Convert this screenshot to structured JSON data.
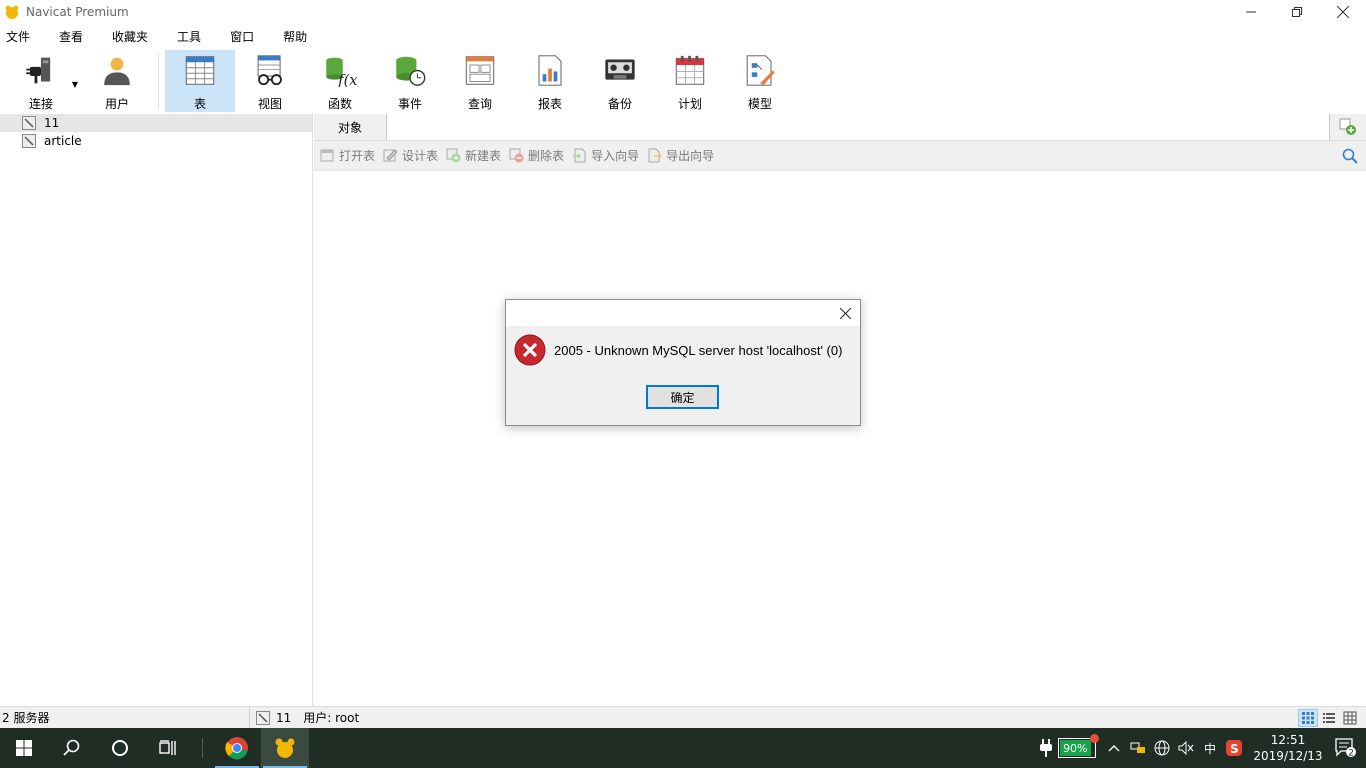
{
  "window": {
    "title": "Navicat Premium"
  },
  "menu": [
    "文件",
    "查看",
    "收藏夹",
    "工具",
    "窗口",
    "帮助"
  ],
  "toolbar": {
    "connect": "连接",
    "user": "用户",
    "table": "表",
    "view": "视图",
    "function": "函数",
    "event": "事件",
    "query": "查询",
    "report": "报表",
    "backup": "备份",
    "schedule": "计划",
    "model": "模型"
  },
  "tree": {
    "items": [
      "11",
      "article"
    ]
  },
  "tabs": {
    "objects": "对象"
  },
  "object_toolbar": {
    "open_table": "打开表",
    "design_table": "设计表",
    "new_table": "新建表",
    "delete_table": "删除表",
    "import_wizard": "导入向导",
    "export_wizard": "导出向导"
  },
  "status": {
    "servers": "2 服务器",
    "connection": "11",
    "user": "用户: root"
  },
  "dialog": {
    "message": "2005 - Unknown MySQL server host 'localhost' (0)",
    "ok": "确定"
  },
  "tray": {
    "battery": "90%",
    "ime": "中",
    "time": "12:51",
    "date": "2019/12/13",
    "notifications": "2"
  }
}
